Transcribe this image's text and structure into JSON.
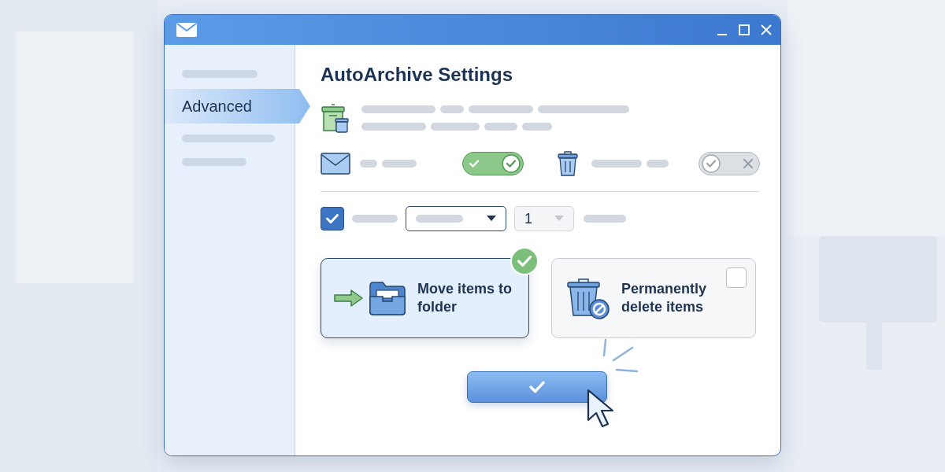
{
  "sidebar": {
    "items": [
      {
        "kind": "skeleton",
        "selected": false
      },
      {
        "kind": "label",
        "label": "Advanced",
        "selected": true
      },
      {
        "kind": "skeleton",
        "selected": false
      },
      {
        "kind": "skeleton",
        "selected": false
      }
    ]
  },
  "heading": "AutoArchive Settings",
  "toggles": [
    {
      "on": true
    },
    {
      "on": false
    }
  ],
  "checkbox": {
    "checked": true
  },
  "number_dropdown": {
    "value": "1",
    "disabled": true
  },
  "options": [
    {
      "kind": "move",
      "label": "Move items to folder",
      "selected": true
    },
    {
      "kind": "delete",
      "label": "Permanently delete items",
      "selected": false
    }
  ]
}
